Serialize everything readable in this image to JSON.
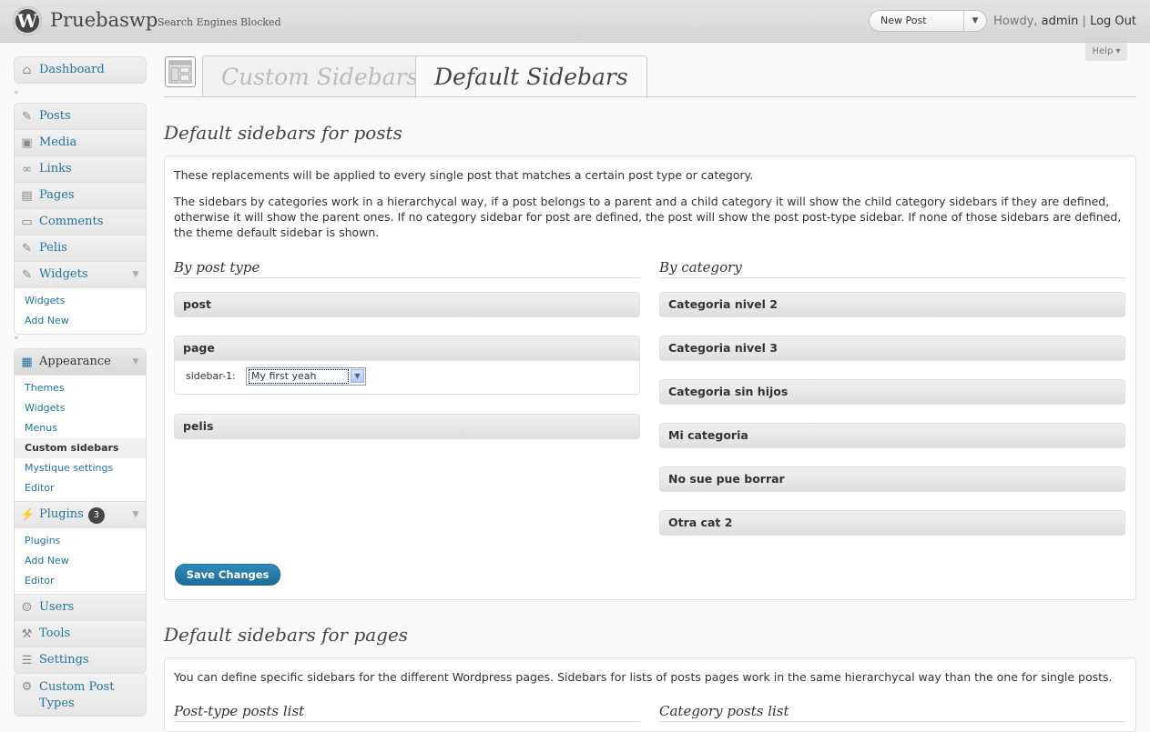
{
  "header": {
    "site_title": "Pruebaswp",
    "site_subtitle": "Search Engines Blocked",
    "new_post_label": "New Post",
    "howdy": "Howdy,",
    "username": "admin",
    "separator": "|",
    "logout": "Log Out",
    "help": "Help ▾"
  },
  "menu": {
    "dashboard": "Dashboard",
    "posts": "Posts",
    "media": "Media",
    "links": "Links",
    "pages": "Pages",
    "comments": "Comments",
    "pelis": "Pelis",
    "widgets": "Widgets",
    "widgets_sub": [
      "Widgets",
      "Add New"
    ],
    "appearance": "Appearance",
    "appearance_sub": [
      "Themes",
      "Widgets",
      "Menus",
      "Custom sidebars",
      "Mystique settings",
      "Editor"
    ],
    "plugins": "Plugins",
    "plugins_badge": "3",
    "plugins_sub": [
      "Plugins",
      "Add New",
      "Editor"
    ],
    "users": "Users",
    "tools": "Tools",
    "settings": "Settings",
    "custom_post_types": "Custom Post Types"
  },
  "tabs": {
    "custom": "Custom Sidebars",
    "default": "Default Sidebars"
  },
  "posts_section": {
    "title": "Default sidebars for posts",
    "desc1": "These replacements will be applied to every single post that matches a certain post type or category.",
    "desc2": "The sidebars by categories work in a hierarchycal way, if a post belongs to a parent and a child category it will show the child category sidebars if they are defined, otherwise it will show the parent ones. If no category sidebar for post are defined, the post will show the post post-type sidebar. If none of those sidebars are defined, the theme default sidebar is shown.",
    "by_post_type": "By post type",
    "by_category": "By category",
    "post_types": [
      "post",
      "page",
      "pelis"
    ],
    "sidebar_label": "sidebar-1:",
    "sidebar_value": "My first yeah",
    "categories": [
      "Categoria nivel 2",
      "Categoria nivel 3",
      "Categoria sin hijos",
      "Mi categoria",
      "No sue pue borrar",
      "Otra cat 2"
    ],
    "save": "Save Changes"
  },
  "pages_section": {
    "title": "Default sidebars for pages",
    "desc": "You can define specific sidebars for the different Wordpress pages. Sidebars for lists of posts pages work in the same hierarchycal way than the one for single posts.",
    "col1": "Post-type posts list",
    "col2": "Category posts list"
  }
}
